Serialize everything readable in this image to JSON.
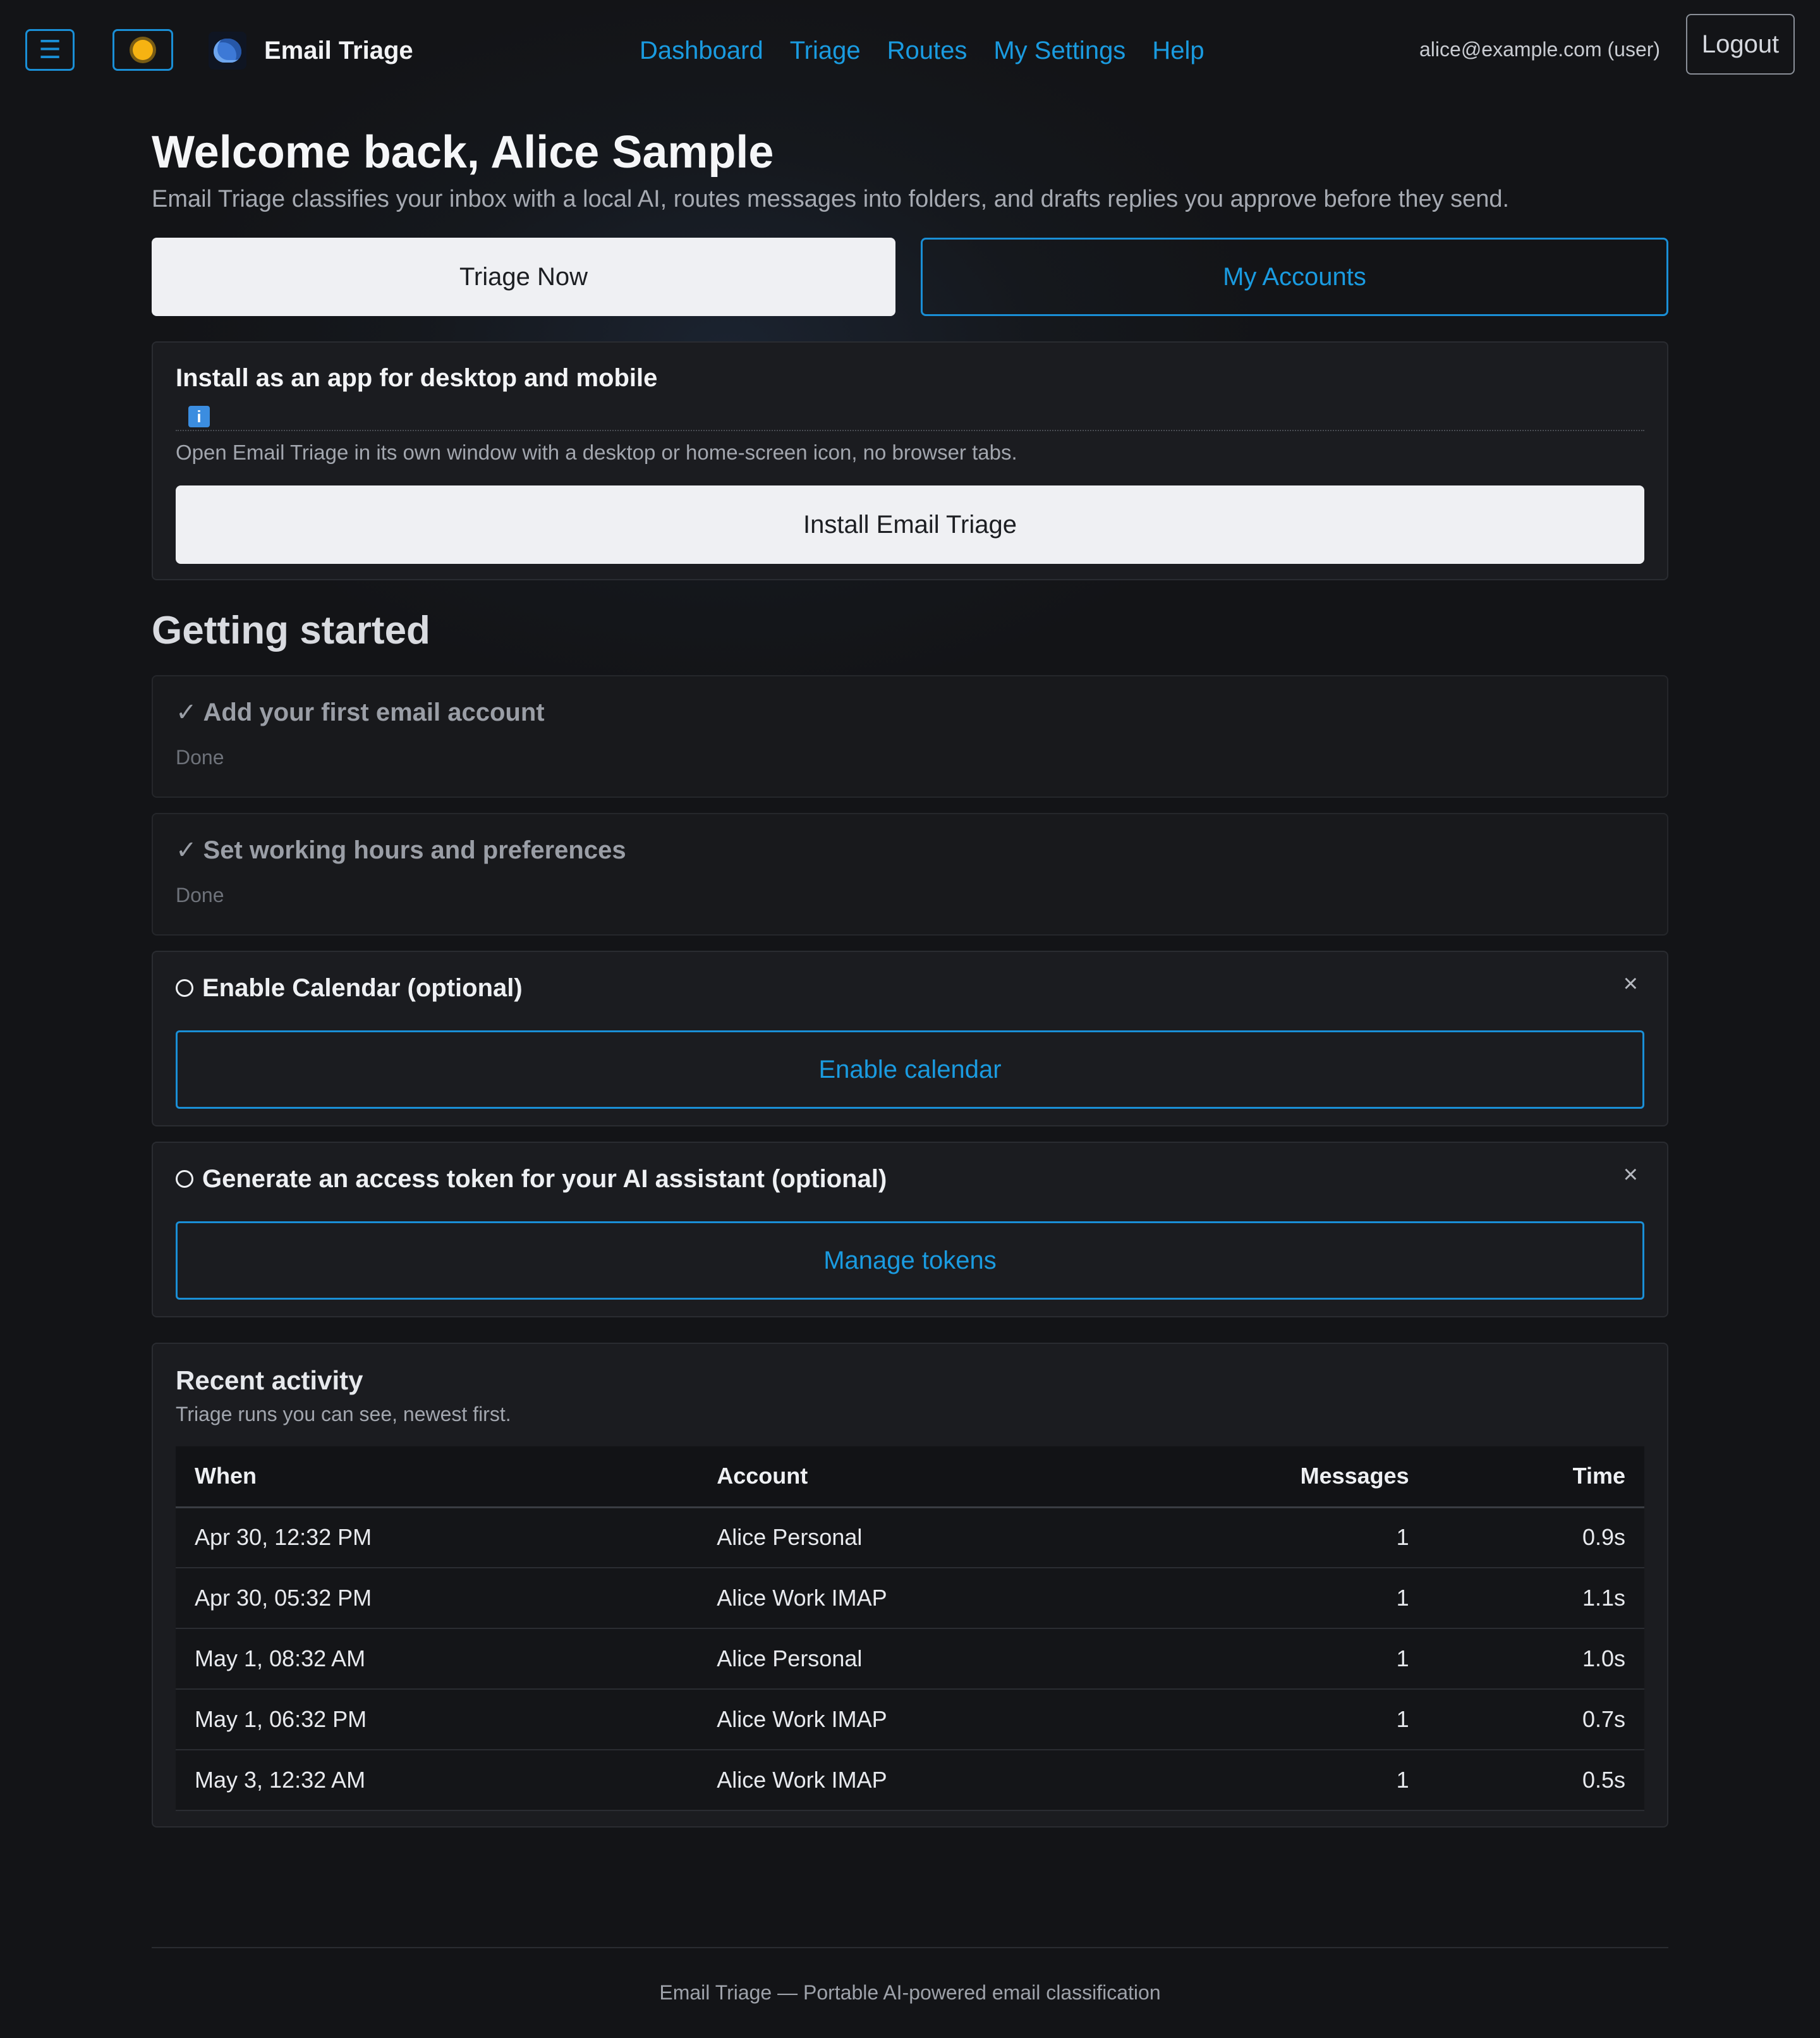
{
  "header": {
    "menu_icon": "hamburger-icon",
    "theme_icon": "sun-icon",
    "brand_icon": "brain-icon",
    "brand_name": "Email Triage",
    "nav": [
      "Dashboard",
      "Triage",
      "Routes",
      "My Settings",
      "Help"
    ],
    "user": "alice@example.com (user)",
    "logout_label": "Logout",
    "accent_color": "#1a9be0"
  },
  "welcome": {
    "title": "Welcome back, Alice Sample",
    "intro": "Email Triage classifies your inbox with a local AI, routes messages into folders, and drafts replies you approve before they send.",
    "primary_button": "Triage Now",
    "secondary_button": "My Accounts"
  },
  "install": {
    "title": "Install as an app for desktop and mobile",
    "info_icon": "info-icon",
    "description": "Open Email Triage in its own window with a desktop or home-screen icon, no browser tabs.",
    "button": "Install Email Triage"
  },
  "getting_started": {
    "heading": "Getting started",
    "steps": [
      {
        "marker": "✓",
        "title": "Add your first email account",
        "status": "Done"
      },
      {
        "marker": "✓",
        "title": "Set working hours and preferences",
        "status": "Done"
      },
      {
        "marker": "○",
        "title": "Enable Calendar (optional)",
        "button": "Enable calendar",
        "dismiss": "×"
      },
      {
        "marker": "○",
        "title": "Generate an access token for your AI assistant (optional)",
        "button": "Manage tokens",
        "dismiss": "×"
      }
    ]
  },
  "activity": {
    "title": "Recent activity",
    "subtitle": "Triage runs you can see, newest first.",
    "columns": [
      "When",
      "Account",
      "Messages",
      "Time"
    ],
    "rows": [
      [
        "Apr 30, 12:32 PM",
        "Alice Personal",
        "1",
        "0.9s"
      ],
      [
        "Apr 30, 05:32 PM",
        "Alice Work IMAP",
        "1",
        "1.1s"
      ],
      [
        "May 1, 08:32 AM",
        "Alice Personal",
        "1",
        "1.0s"
      ],
      [
        "May 1, 06:32 PM",
        "Alice Work IMAP",
        "1",
        "0.7s"
      ],
      [
        "May 3, 12:32 AM",
        "Alice Work IMAP",
        "1",
        "0.5s"
      ]
    ]
  },
  "footer": "Email Triage — Portable AI-powered email classification"
}
